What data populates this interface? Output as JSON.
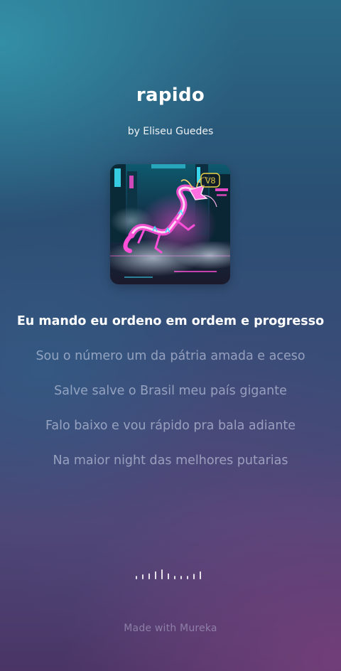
{
  "song": {
    "title": "rapido",
    "artist_line": "by Eliseu Guedes",
    "cover_badge": "V8"
  },
  "lyrics": [
    {
      "text": "Eu mando eu ordeno em ordem e progresso",
      "active": true
    },
    {
      "text": "Sou o número um da pátria amada e aceso",
      "active": false
    },
    {
      "text": "Salve salve o Brasil meu país gigante",
      "active": false
    },
    {
      "text": "Falo baixo e vou rápido pra bala adiante",
      "active": false
    },
    {
      "text": "Na maior night das melhores putarias",
      "active": false
    }
  ],
  "waveform": {
    "bar_levels": [
      0.35,
      0.5,
      0.6,
      0.8,
      1.0,
      0.6,
      0.35,
      0.35,
      0.35,
      0.55,
      0.8
    ]
  },
  "footer": {
    "credit": "Made with Mureka"
  },
  "colors": {
    "active_lyric": "#ffffff",
    "inactive_lyric": "#cdd4e8",
    "neon_pink": "#ff4fd8",
    "neon_cyan": "#3ee8ff",
    "badge": "#e9d24a"
  }
}
